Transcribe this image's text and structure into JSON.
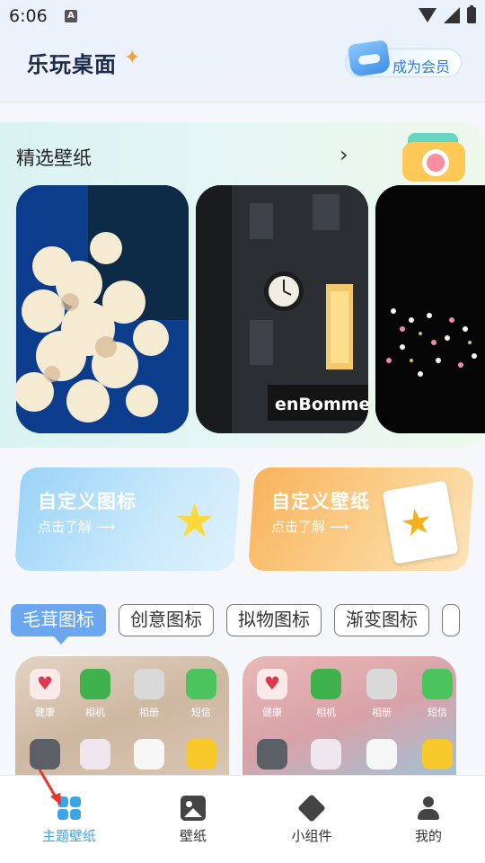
{
  "status_bar": {
    "time": "6:06",
    "notification_icon": "A"
  },
  "header": {
    "title": "乐玩桌面",
    "vip_button": "成为会员"
  },
  "featured": {
    "title": "精选壁纸",
    "more_icon": "chevron-right-icon"
  },
  "shortcuts": [
    {
      "title": "自定义图标",
      "subtitle": "点击了解 ⟶"
    },
    {
      "title": "自定义壁纸",
      "subtitle": "点击了解 ⟶"
    }
  ],
  "icon_tabs": [
    "毛茸图标",
    "创意图标",
    "拟物图标",
    "渐变图标"
  ],
  "theme_preview": {
    "app_labels": [
      "健康",
      "相机",
      "相册",
      "短信"
    ]
  },
  "bottom_nav": [
    {
      "label": "主题壁纸",
      "icon": "grid-icon",
      "active": true
    },
    {
      "label": "壁纸",
      "icon": "image-icon",
      "active": false
    },
    {
      "label": "小组件",
      "icon": "cube-icon",
      "active": false
    },
    {
      "label": "我的",
      "icon": "user-icon",
      "active": false
    }
  ],
  "colors": {
    "accent": "#3aa6e8",
    "active_tab": "#6aa7ef",
    "vip_text": "#2e7ad8"
  }
}
